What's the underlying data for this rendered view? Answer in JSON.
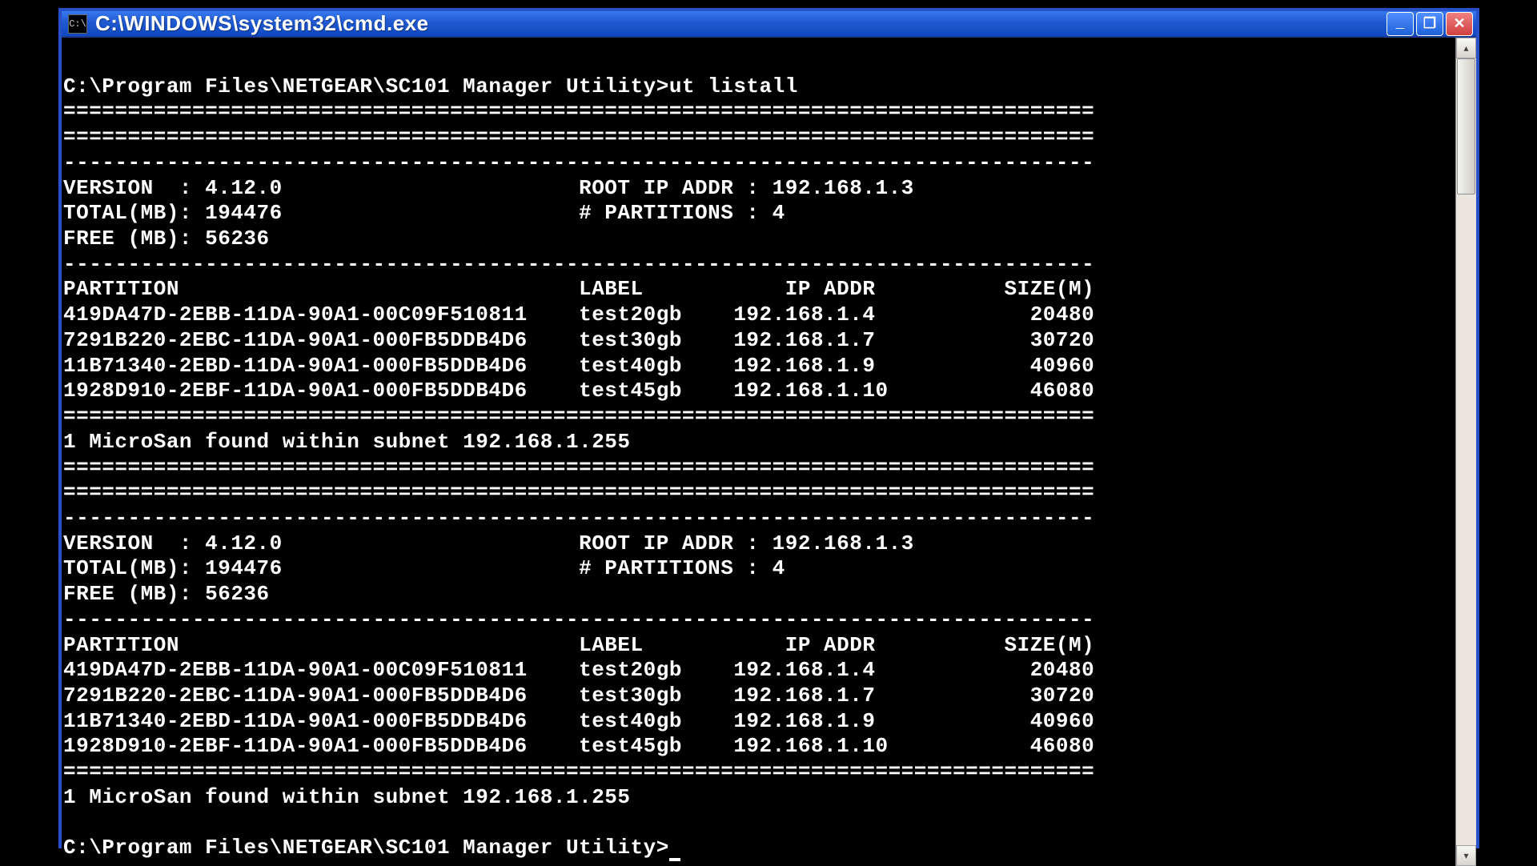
{
  "window": {
    "title": "C:\\WINDOWS\\system32\\cmd.exe",
    "icon_label": "C:\\"
  },
  "console": {
    "prompt_path": "C:\\Program Files\\NETGEAR\\SC101 Manager Utility>",
    "command": "ut listall",
    "sep_eq": "================================================================================",
    "sep_dash": "--------------------------------------------------------------------------------",
    "info": {
      "version_label": "VERSION  :",
      "version_value": "4.12.0",
      "root_ip_label": "ROOT IP ADDR :",
      "root_ip_value": "192.168.1.3",
      "total_label": "TOTAL(MB):",
      "total_value": "194476",
      "partitions_label": "# PARTITIONS :",
      "partitions_value": "4",
      "free_label": "FREE (MB):",
      "free_value": "56236"
    },
    "headers": {
      "partition": "PARTITION",
      "label": "LABEL",
      "ip": "IP ADDR",
      "size": "SIZE(M)"
    },
    "rows": [
      {
        "partition": "419DA47D-2EBB-11DA-90A1-00C09F510811",
        "label": "test20gb",
        "ip": "192.168.1.4",
        "size": "20480"
      },
      {
        "partition": "7291B220-2EBC-11DA-90A1-000FB5DDB4D6",
        "label": "test30gb",
        "ip": "192.168.1.7",
        "size": "30720"
      },
      {
        "partition": "11B71340-2EBD-11DA-90A1-000FB5DDB4D6",
        "label": "test40gb",
        "ip": "192.168.1.9",
        "size": "40960"
      },
      {
        "partition": "1928D910-2EBF-11DA-90A1-000FB5DDB4D6",
        "label": "test45gb",
        "ip": "192.168.1.10",
        "size": "46080"
      }
    ],
    "found_line": "1 MicroSan found within subnet 192.168.1.255"
  }
}
